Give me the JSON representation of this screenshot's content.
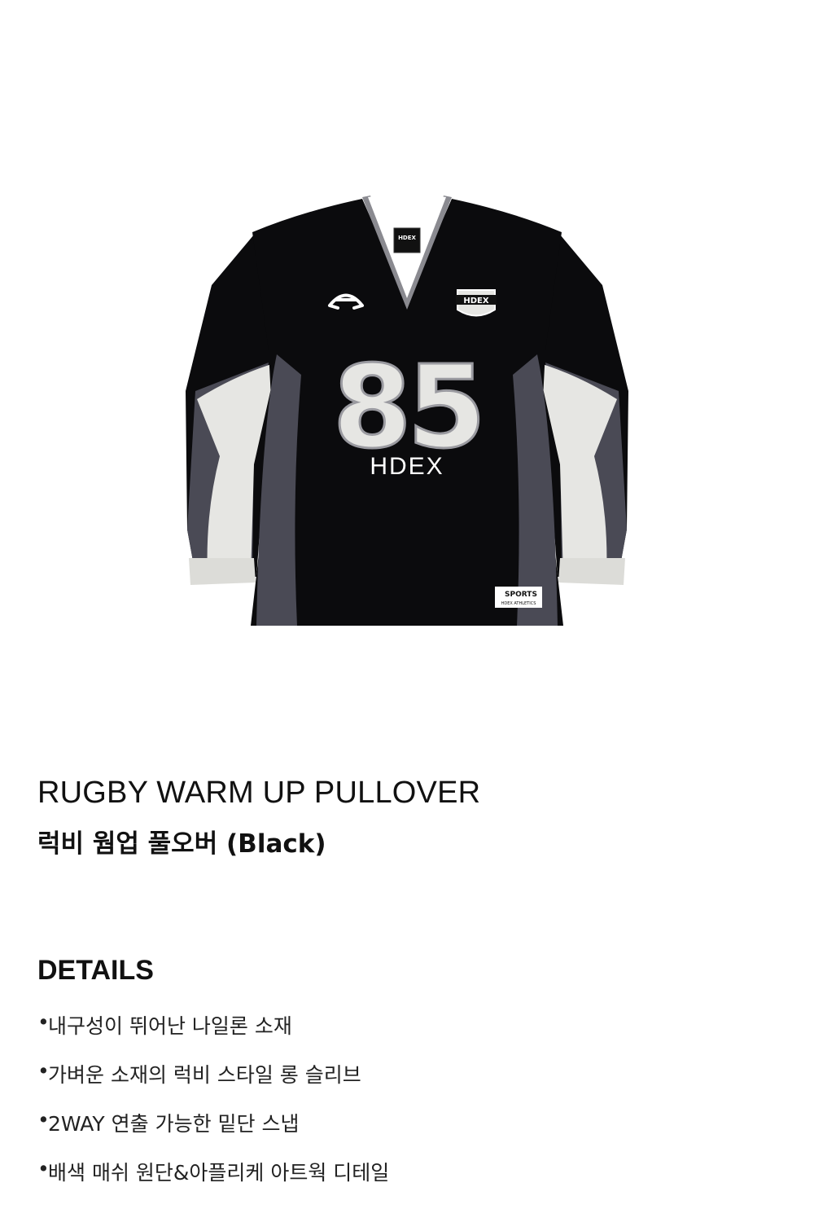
{
  "product": {
    "title_en": "RUGBY WARM UP PULLOVER",
    "title_ko": "럭비 웜업 풀오버 (Black)",
    "image": {
      "neck_tag": "HDEX",
      "chest_number": "85",
      "chest_text": "HDEX",
      "badge_text": "HDEX",
      "hem_label_top": "SPORTS",
      "hem_label_bottom": "HDEX ATHLETICS",
      "colors": {
        "body": "#0b0b0d",
        "panel_dark": "#4a4a55",
        "panel_light": "#e6e6e3",
        "trim": "#8a8a90"
      }
    }
  },
  "details": {
    "heading": "DETAILS",
    "bullet": "•",
    "items": [
      "내구성이 뛰어난 나일론 소재",
      "가벼운 소재의 럭비 스타일 롱 슬리브",
      "2WAY 연출 가능한 밑단 스냅",
      "배색 매쉬 원단&아플리케 아트웍 디테일"
    ]
  }
}
